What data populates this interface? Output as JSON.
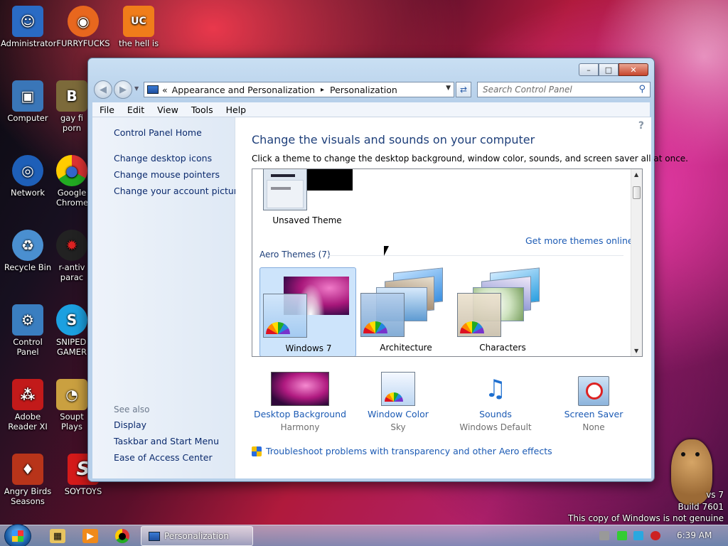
{
  "desktop": {
    "icons": [
      {
        "label": "Administrator",
        "icon": "user-folder-icon",
        "color": "#2a6bc4",
        "glyph": "☺"
      },
      {
        "label": "FURRYFUCKS",
        "icon": "firefox-icon",
        "color": "#e8671e",
        "glyph": "◉"
      },
      {
        "label": "the hell is with",
        "icon": "uc-browser-icon",
        "color": "#f07d1a",
        "glyph": "UC"
      },
      {
        "label": "Computer",
        "icon": "computer-icon",
        "color": "#3a76b8",
        "glyph": "▣"
      },
      {
        "label": "gay fi porn",
        "icon": "game-icon",
        "color": "#7c6a3a",
        "glyph": "B"
      },
      {
        "label": "Network",
        "icon": "network-icon",
        "color": "#1e5fb8",
        "glyph": "◎"
      },
      {
        "label": "Google Chrome",
        "icon": "chrome-icon",
        "color": "#3c9a3c",
        "glyph": "●"
      },
      {
        "label": "Recycle Bin",
        "icon": "recycle-bin-icon",
        "color": "#4a8fd0",
        "glyph": "♻"
      },
      {
        "label": "r-antiv parac",
        "icon": "antivirus-icon",
        "color": "#222222",
        "glyph": "✹"
      },
      {
        "label": "Control Panel",
        "icon": "control-panel-icon",
        "color": "#3a7ec0",
        "glyph": "⚙"
      },
      {
        "label": "SNIPED! GAMER",
        "icon": "skype-icon",
        "color": "#1ca0e0",
        "glyph": "S"
      },
      {
        "label": "Adobe Reader XI",
        "icon": "adobe-reader-icon",
        "color": "#c21a1a",
        "glyph": "⁂"
      },
      {
        "label": "Soupt Plays",
        "icon": "soup-icon",
        "color": "#caa040",
        "glyph": "◔"
      },
      {
        "label": "Angry Birds Seasons",
        "icon": "angry-birds-icon",
        "color": "#b8341a",
        "glyph": "♦"
      },
      {
        "label": "SOYTOYS",
        "icon": "soytoys-icon",
        "color": "#d41a1a",
        "glyph": "S"
      }
    ],
    "watermark": {
      "line1": "vs 7",
      "line2": "Build 7601",
      "line3": "This copy of Windows is not genuine"
    }
  },
  "window": {
    "title": "Personalization",
    "controls": {
      "minimize": "–",
      "maximize": "□",
      "close": "✕"
    },
    "address": {
      "separator": "«",
      "crumb1": "Appearance and Personalization",
      "arrow": "▸",
      "crumb2": "Personalization"
    },
    "search_placeholder": "Search Control Panel",
    "menu": [
      "File",
      "Edit",
      "View",
      "Tools",
      "Help"
    ],
    "sidebar": {
      "home": "Control Panel Home",
      "links": [
        "Change desktop icons",
        "Change mouse pointers",
        "Change your account picture"
      ],
      "see_also": "See also",
      "see_also_links": [
        "Display",
        "Taskbar and Start Menu",
        "Ease of Access Center"
      ]
    },
    "main": {
      "heading": "Change the visuals and sounds on your computer",
      "subtitle": "Click a theme to change the desktop background, window color, sounds, and screen saver all at once.",
      "unsaved_theme": "Unsaved Theme",
      "get_more": "Get more themes online",
      "group_label": "Aero Themes (7)",
      "themes": [
        "Windows 7",
        "Architecture",
        "Characters"
      ],
      "bottom": [
        {
          "label": "Desktop Background",
          "value": "Harmony"
        },
        {
          "label": "Window Color",
          "value": "Sky"
        },
        {
          "label": "Sounds",
          "value": "Windows Default"
        },
        {
          "label": "Screen Saver",
          "value": "None"
        }
      ],
      "troubleshoot": "Troubleshoot problems with transparency and other Aero effects"
    }
  },
  "taskbar": {
    "active_task": "Personalization",
    "clock": "6:39 AM"
  },
  "colors": {
    "link": "#1b5ab4",
    "heading": "#1e3f7a",
    "selected": "#cde4fb"
  }
}
